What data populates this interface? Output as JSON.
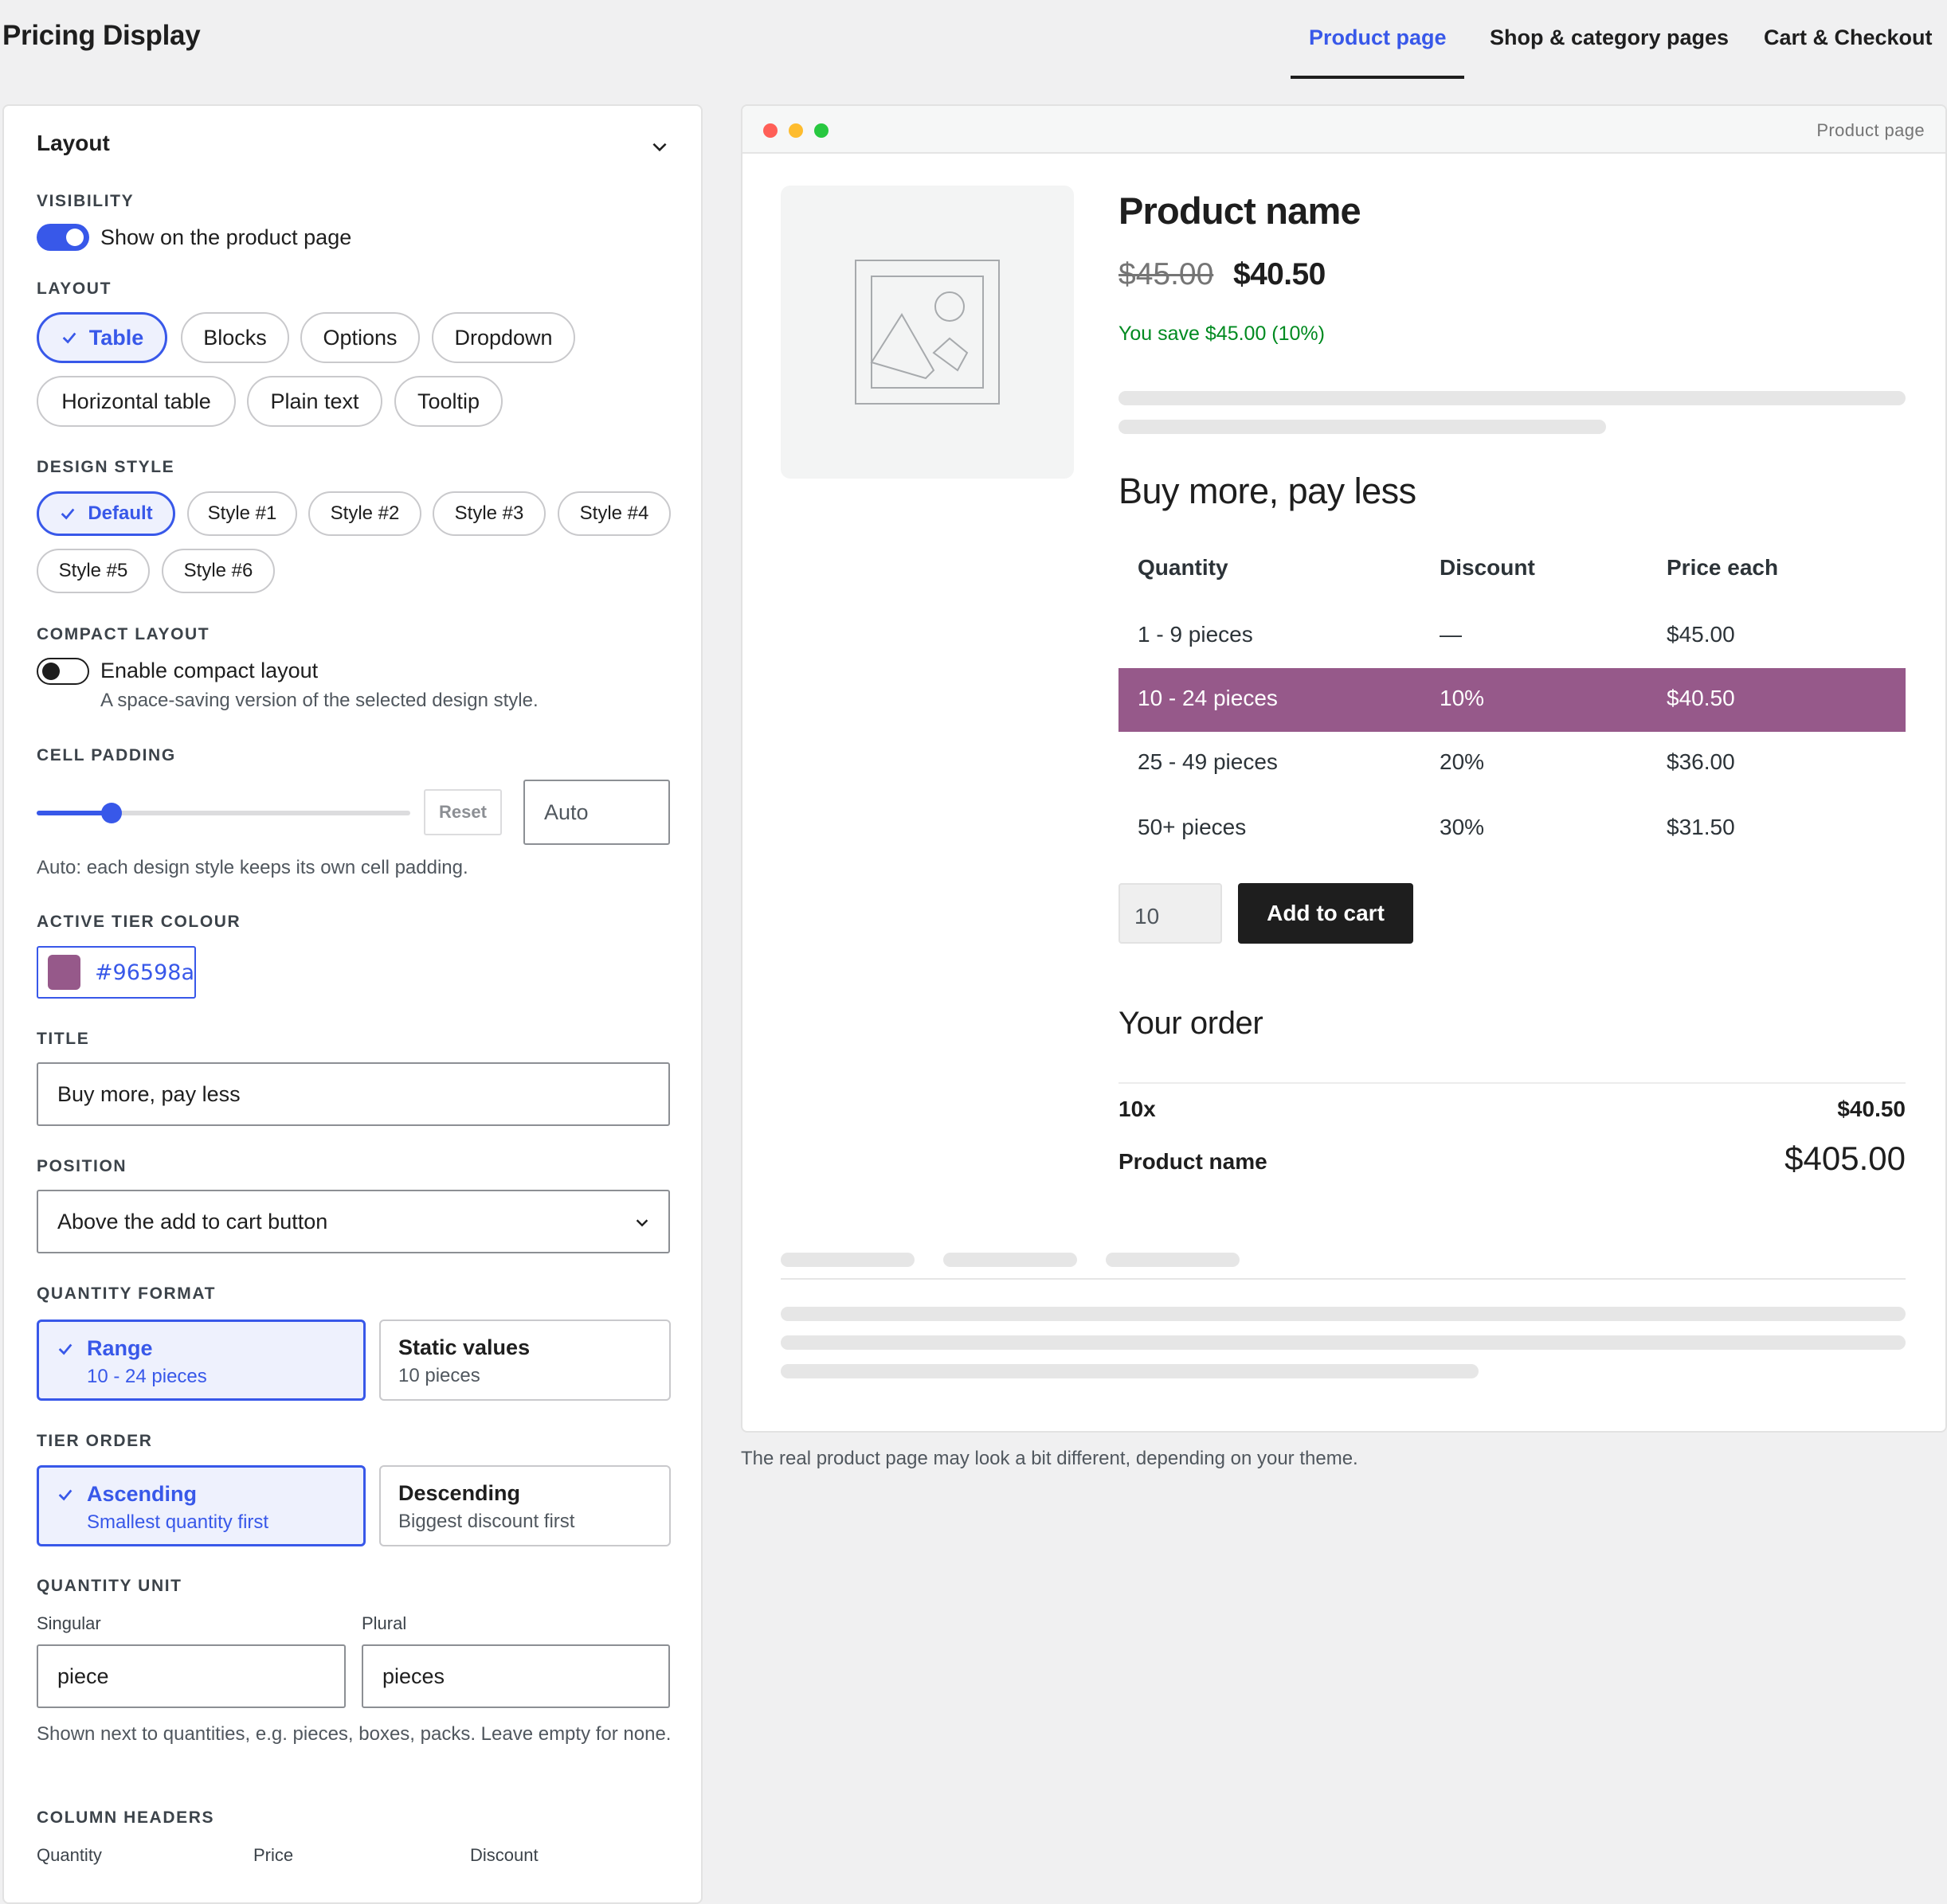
{
  "header": {
    "title": "Pricing Display",
    "tabs": [
      "Product page",
      "Shop & category pages",
      "Cart & Checkout"
    ],
    "active_tab": "Product page"
  },
  "panel": {
    "heading": "Layout",
    "visibility": {
      "label": "VISIBILITY",
      "toggle_text": "Show on the product page",
      "enabled": true
    },
    "layout": {
      "label": "LAYOUT",
      "options": [
        "Table",
        "Blocks",
        "Options",
        "Dropdown",
        "Horizontal table",
        "Plain text",
        "Tooltip"
      ],
      "selected": "Table"
    },
    "design_style": {
      "label": "DESIGN STYLE",
      "options": [
        "Default",
        "Style #1",
        "Style #2",
        "Style #3",
        "Style #4",
        "Style #5",
        "Style #6"
      ],
      "selected": "Default"
    },
    "compact": {
      "label": "COMPACT LAYOUT",
      "toggle_text": "Enable compact layout",
      "help": "A space-saving version of the selected design style.",
      "enabled": false
    },
    "cell_padding": {
      "label": "CELL PADDING",
      "reset": "Reset",
      "value": "Auto",
      "help": "Auto: each design style keeps its own cell padding.",
      "slider_fraction": 0.2
    },
    "active_tier_colour": {
      "label": "ACTIVE TIER COLOUR",
      "value": "#96598a"
    },
    "title": {
      "label": "TITLE",
      "value": "Buy more, pay less"
    },
    "position": {
      "label": "POSITION",
      "value": "Above the add to cart button"
    },
    "quantity_format": {
      "label": "QUANTITY FORMAT",
      "options": [
        {
          "title": "Range",
          "sub": "10 - 24 pieces",
          "selected": true
        },
        {
          "title": "Static values",
          "sub": "10 pieces",
          "selected": false
        }
      ]
    },
    "tier_order": {
      "label": "TIER ORDER",
      "options": [
        {
          "title": "Ascending",
          "sub": "Smallest quantity first",
          "selected": true
        },
        {
          "title": "Descending",
          "sub": "Biggest discount first",
          "selected": false
        }
      ]
    },
    "quantity_unit": {
      "label": "QUANTITY UNIT",
      "singular_label": "Singular",
      "singular": "piece",
      "plural_label": "Plural",
      "plural": "pieces",
      "help": "Shown next to quantities, e.g. pieces, boxes, packs. Leave empty for none."
    },
    "column_headers": {
      "label": "COLUMN HEADERS",
      "quantity": "Quantity",
      "price": "Price",
      "discount": "Discount"
    }
  },
  "preview": {
    "window_label": "Product page",
    "product_name": "Product name",
    "old_price": "$45.00",
    "new_price": "$40.50",
    "save_text": "You save $45.00 (10%)",
    "table_title": "Buy more, pay less",
    "headers": [
      "Quantity",
      "Discount",
      "Price each"
    ],
    "rows": [
      {
        "qty": "1 - 9 pieces",
        "discount": "—",
        "price": "$45.00",
        "active": false
      },
      {
        "qty": "10 - 24 pieces",
        "discount": "10%",
        "price": "$40.50",
        "active": true
      },
      {
        "qty": "25 - 49 pieces",
        "discount": "20%",
        "price": "$36.00",
        "active": false
      },
      {
        "qty": "50+ pieces",
        "discount": "30%",
        "price": "$31.50",
        "active": false
      }
    ],
    "quantity": "10",
    "add_to_cart": "Add to cart",
    "order_title": "Your order",
    "order_qty": "10x",
    "order_each": "$40.50",
    "order_name": "Product name",
    "order_total": "$405.00",
    "note": "The real product page may look a bit different, depending on your theme."
  },
  "colors": {
    "accent": "#3858e9",
    "active_tier": "#96598a",
    "save_green": "#008a20"
  }
}
